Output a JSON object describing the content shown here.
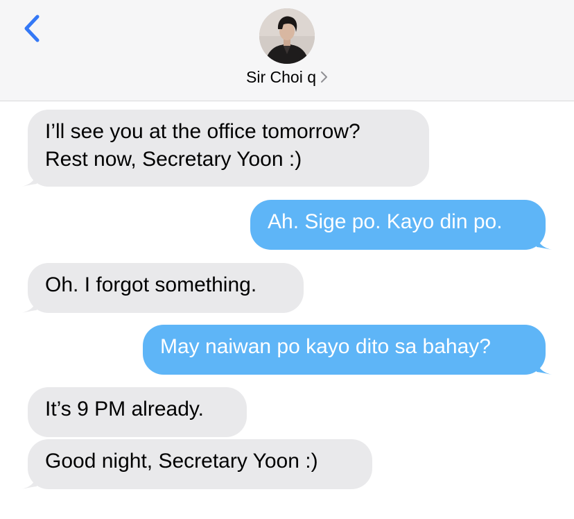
{
  "header": {
    "contact_name": "Sir Choi q",
    "back_icon": "chevron-left-icon",
    "detail_icon": "chevron-right-icon",
    "accent_color": "#3478f6"
  },
  "messages": [
    {
      "direction": "received",
      "lines": [
        "I’ll see you at the office tomorrow?",
        "Rest now, Secretary Yoon :)"
      ]
    },
    {
      "direction": "sent",
      "lines": [
        "Ah. Sige po. Kayo din po."
      ]
    },
    {
      "direction": "received",
      "lines": [
        "Oh. I forgot something."
      ]
    },
    {
      "direction": "sent",
      "lines": [
        "May naiwan po kayo dito sa bahay?"
      ]
    },
    {
      "direction": "received",
      "lines": [
        "It’s 9 PM already."
      ]
    },
    {
      "direction": "received",
      "lines": [
        "Good night, Secretary Yoon :)"
      ]
    }
  ],
  "colors": {
    "received_bubble": "#e9e9eb",
    "sent_bubble": "#5eb5f7",
    "header_bg": "#f6f6f7"
  }
}
